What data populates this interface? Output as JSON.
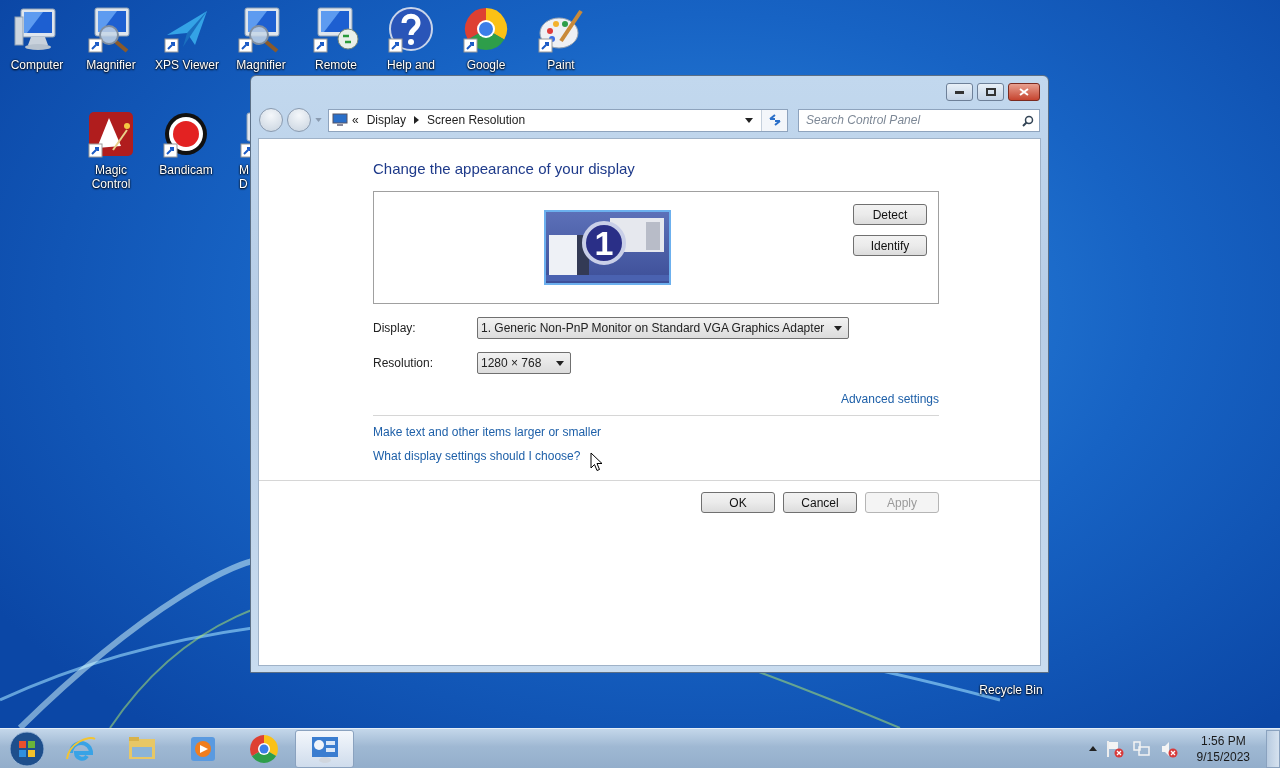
{
  "desktop_icons": [
    {
      "label": "Computer",
      "kind": "computer",
      "shortcut": false
    },
    {
      "label": "Magnifier",
      "kind": "magnifier",
      "shortcut": true
    },
    {
      "label": "XPS Viewer",
      "kind": "xps",
      "shortcut": true
    },
    {
      "label": "Magnifier",
      "kind": "magnifier",
      "shortcut": true
    },
    {
      "label": "Remote",
      "kind": "remote",
      "shortcut": true
    },
    {
      "label": "Help and",
      "kind": "help",
      "shortcut": true
    },
    {
      "label": "Google",
      "kind": "chrome",
      "shortcut": true
    },
    {
      "label": "Paint",
      "kind": "paint",
      "shortcut": true
    },
    {
      "label": "Magic Control",
      "kind": "magic",
      "shortcut": true
    },
    {
      "label": "Bandicam",
      "kind": "bandicam",
      "shortcut": true
    },
    {
      "label": "M D",
      "kind": "monitor",
      "shortcut": true
    },
    {
      "label": "Recycle Bin",
      "kind": "recycle"
    }
  ],
  "window": {
    "breadcrumb_prefix": "«",
    "breadcrumb": [
      "Display",
      "Screen Resolution"
    ],
    "search": {
      "placeholder": "Search Control Panel"
    },
    "heading": "Change the appearance of your display",
    "monitor_number": "1",
    "preview_buttons": [
      {
        "label": "Detect",
        "disabled": false
      },
      {
        "label": "Identify",
        "disabled": false
      }
    ],
    "fields": [
      {
        "label": "Display:",
        "value": "1. Generic Non-PnP Monitor on Standard VGA Graphics Adapter"
      },
      {
        "label": "Resolution:",
        "value": "1280 × 768"
      }
    ],
    "advanced_link": "Advanced settings",
    "links": [
      "Make text and other items larger or smaller",
      "What display settings should I choose?"
    ],
    "buttons": [
      {
        "label": "OK",
        "disabled": false
      },
      {
        "label": "Cancel",
        "disabled": false
      },
      {
        "label": "Apply",
        "disabled": true
      }
    ]
  },
  "taskbar": {
    "apps": [
      {
        "kind": "ie",
        "selected": false
      },
      {
        "kind": "folder",
        "selected": false
      },
      {
        "kind": "media",
        "selected": false
      },
      {
        "kind": "chrome",
        "selected": false
      },
      {
        "kind": "control-panel",
        "selected": true
      }
    ],
    "time": "1:56 PM",
    "date": "9/15/2023"
  }
}
